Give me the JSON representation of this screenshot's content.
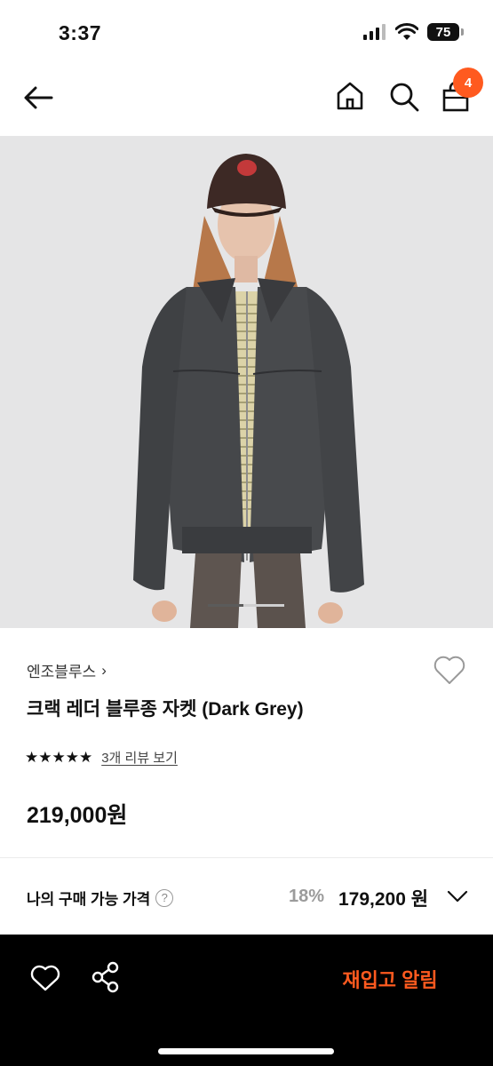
{
  "status_bar": {
    "time": "3:37",
    "battery": "75"
  },
  "nav": {
    "icons": [
      "back-arrow-icon",
      "home-icon",
      "search-icon",
      "shopping-bag-icon"
    ],
    "cart_count": "4"
  },
  "product": {
    "brand": "엔조블루스",
    "brand_chevron": "›",
    "title": "크랙 레더 블루종 자켓 (Dark Grey)",
    "stars": "★★★★★",
    "rating": 5,
    "review_link": "3개 리뷰 보기",
    "price": "219,000원"
  },
  "my_price": {
    "label": "나의 구매 가능 가격",
    "help": "?",
    "discount": "18%",
    "final_price": "179,200 원"
  },
  "bottom_bar": {
    "restock_label": "재입고 알림",
    "icons": [
      "heart-icon",
      "share-icon"
    ]
  },
  "colors": {
    "accent": "#ff5a1f",
    "bottom_bar": "#000000",
    "discount": "#9b9b9b"
  }
}
